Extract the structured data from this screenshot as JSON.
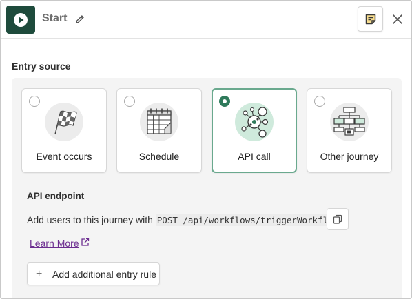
{
  "header": {
    "title": "Start",
    "play_icon": "play-circle-icon",
    "edit_icon": "pencil-icon",
    "note_icon": "sticky-note-icon",
    "close_icon": "close-icon"
  },
  "entry_source": {
    "title": "Entry source",
    "options": [
      {
        "label": "Event occurs",
        "icon": "checkered-flag-icon",
        "selected": false
      },
      {
        "label": "Schedule",
        "icon": "calendar-icon",
        "selected": false
      },
      {
        "label": "API call",
        "icon": "api-network-icon",
        "selected": true
      },
      {
        "label": "Other journey",
        "icon": "flowchart-icon",
        "selected": false
      }
    ]
  },
  "api_endpoint": {
    "title": "API endpoint",
    "description_prefix": "Add users to this journey with",
    "code": "POST /api/workflows/triggerWorkflow",
    "copy_icon": "copy-icon",
    "learn_more": "Learn More",
    "external_icon": "external-link-icon"
  },
  "add_rule": {
    "label": "Add additional entry rule",
    "icon": "plus-icon"
  },
  "colors": {
    "brand_dark_green": "#1e4b3c",
    "selected_border": "#6aa98e",
    "radio_selected": "#2f7a5b",
    "illustration_green": "#cfeadc",
    "link_purple": "#6b2c8f"
  }
}
